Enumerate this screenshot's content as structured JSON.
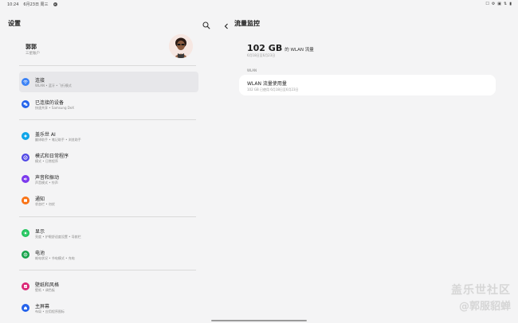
{
  "status_bar": {
    "time": "10:24",
    "date": "6月23日 周三",
    "right_icons": [
      "☐",
      "⚙",
      "▣",
      "⇅",
      "▮"
    ]
  },
  "left": {
    "title": "设置",
    "profile": {
      "name": "郭郭",
      "subtitle": "三星账户"
    },
    "groups": [
      [
        {
          "key": "connections",
          "title": "连接",
          "subtitle": "WLAN • 蓝牙 • 飞行模式",
          "icon": "wifi-icon",
          "color": "#3b82f6",
          "active": true
        },
        {
          "key": "connected-devices",
          "title": "已连接的设备",
          "subtitle": "快速共享 • Samsung DeX",
          "icon": "devices-icon",
          "color": "#2563eb",
          "active": false
        }
      ],
      [
        {
          "key": "galaxy-ai",
          "title": "盖乐世 AI",
          "subtitle": "翻译助手 • 笔记助手 • 浏览助手",
          "icon": "star-icon",
          "color": "#0ea5e9",
          "active": false
        },
        {
          "key": "modes-routines",
          "title": "模式和日常程序",
          "subtitle": "模式 • 日常程序",
          "icon": "check-circle-icon",
          "color": "#4f46e5",
          "active": false
        },
        {
          "key": "sound-vibration",
          "title": "声音和振动",
          "subtitle": "声音模式 • 铃声",
          "icon": "speaker-icon",
          "color": "#7c3aed",
          "active": false
        },
        {
          "key": "notifications",
          "title": "通知",
          "subtitle": "状态栏 • 勿扰",
          "icon": "bell-icon",
          "color": "#f97316",
          "active": false
        }
      ],
      [
        {
          "key": "display",
          "title": "显示",
          "subtitle": "亮度 • 护眼舒适度设置 • 导航栏",
          "icon": "sun-icon",
          "color": "#22c55e",
          "active": false
        },
        {
          "key": "battery",
          "title": "电池",
          "subtitle": "耗电状况 • 节电模式 • 充电",
          "icon": "battery-icon",
          "color": "#16a34a",
          "active": false
        }
      ],
      [
        {
          "key": "wallpaper",
          "title": "壁纸和风格",
          "subtitle": "壁纸 • 调色板",
          "icon": "wallpaper-icon",
          "color": "#db2777",
          "active": false
        },
        {
          "key": "home-screen",
          "title": "主屏幕",
          "subtitle": "布局 • 应用程序图标",
          "icon": "home-icon",
          "color": "#2563eb",
          "active": false
        }
      ]
    ]
  },
  "right": {
    "title": "流量监控",
    "usage_value": "102 GB",
    "usage_label": "的 WLAN 流量",
    "usage_date": "6月18日至6月23日",
    "section_label": "WLAN",
    "card_title": "WLAN 流量使用量",
    "card_subtitle": "102 GB 已使用 6月18日至6月23日"
  },
  "watermark": {
    "line1": "盖乐世社区",
    "line2": "@郭服貂蝉"
  }
}
